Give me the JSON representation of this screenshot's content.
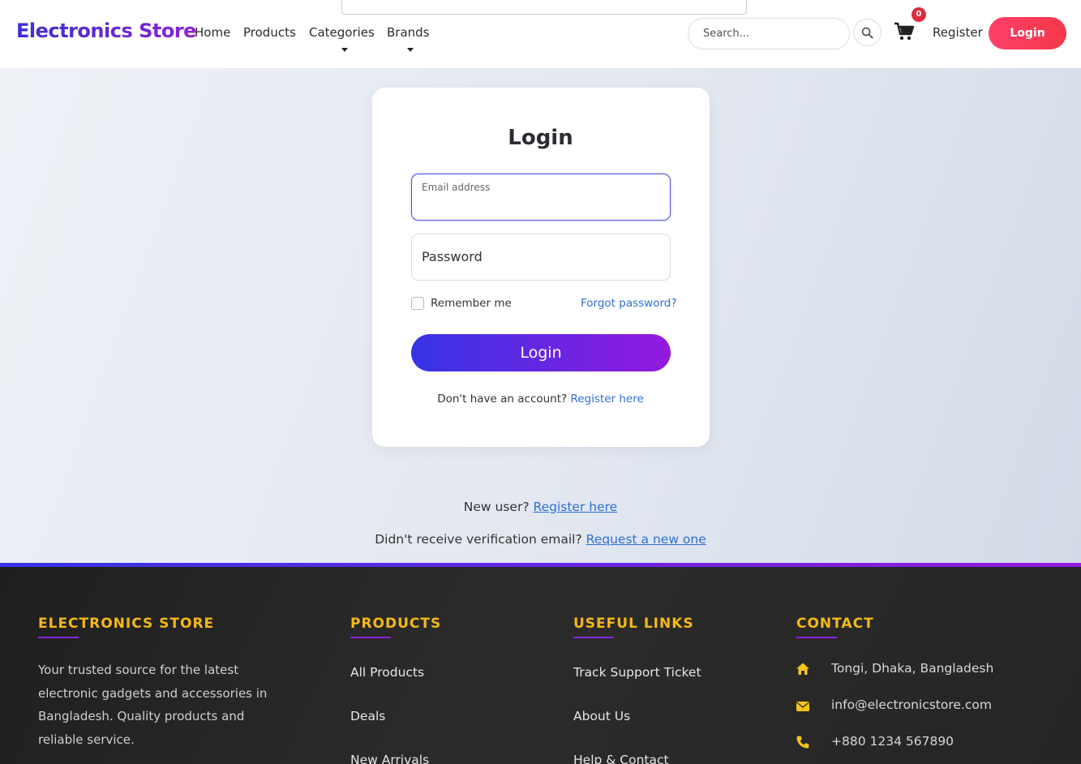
{
  "navbar": {
    "brand": "Electronics Store",
    "links": [
      "Home",
      "Products",
      "Categories",
      "Brands"
    ],
    "search_placeholder": "Search...",
    "cart_count": "0",
    "register_label": "Register",
    "login_label": "Login",
    "icons": {
      "search": "search-icon",
      "cart": "cart-icon"
    }
  },
  "login_form": {
    "title": "Login",
    "email_label": "Email address",
    "password_label": "Password",
    "remember_label": "Remember me",
    "forgot_label": "Forgot password?",
    "submit_label": "Login",
    "no_account_text": "Don't have an account?",
    "register_link": "Register here"
  },
  "below_card": {
    "new_user_text": "New user?",
    "new_user_link": "Register here",
    "verify_text": "Didn't receive verification email?",
    "verify_link": "Request a new one"
  },
  "footer": {
    "about": {
      "heading": "ELECTRONICS STORE",
      "text": "Your trusted source for the latest electronic gadgets and accessories in Bangladesh. Quality products and reliable service."
    },
    "products": {
      "heading": "PRODUCTS",
      "links": [
        "All Products",
        "Deals",
        "New Arrivals"
      ]
    },
    "useful_links": {
      "heading": "USEFUL LINKS",
      "links": [
        "Track Support Ticket",
        "About Us",
        "Help & Contact"
      ]
    },
    "contact": {
      "heading": "CONTACT",
      "address": "Tongi, Dhaka, Bangladesh",
      "email": "info@electronicstore.com",
      "phone": "+880 1234 567890",
      "icons": [
        "home-icon",
        "envelope-icon",
        "phone-icon"
      ]
    }
  },
  "colors": {
    "brand_gradient_start": "#3a2fd6",
    "brand_gradient_end": "#8b22d8",
    "login_nav_button": "#f53849",
    "link_blue": "#2e6fd6",
    "footer_heading": "#f5b914",
    "footer_bg": "#252525",
    "badge": "#dc2c3e"
  }
}
